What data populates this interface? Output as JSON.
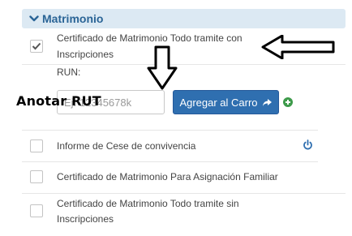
{
  "section": {
    "title": "Matrimonio"
  },
  "items": [
    {
      "label_line1": "Certificado de Matrimonio Todo tramite con",
      "label_line2": "Inscripciones",
      "checked": true
    },
    {
      "label_line1": "Informe de Cese de convivencia",
      "label_line2": "",
      "checked": false
    },
    {
      "label_line1": "Certificado de Matrimonio Para Asignación Familiar",
      "label_line2": "",
      "checked": false
    },
    {
      "label_line1": "Certificado de Matrimonio Todo tramite sin",
      "label_line2": "Inscripciones",
      "checked": false
    }
  ],
  "run": {
    "label": "RUN:",
    "placeholder": "Ej. 12345678k"
  },
  "cart_button": {
    "label": "Agregar al Carro",
    "icon": "share-arrow-icon"
  },
  "annotation": {
    "text": "Anotar RUT"
  },
  "icons": {
    "plus": "plus-circle-icon",
    "power": "power-icon",
    "chevron": "chevron-down-icon"
  },
  "colors": {
    "accent": "#2f6fb0",
    "header_bg": "#dce9f3",
    "header_text": "#2a6496",
    "success": "#3d9a4a"
  }
}
